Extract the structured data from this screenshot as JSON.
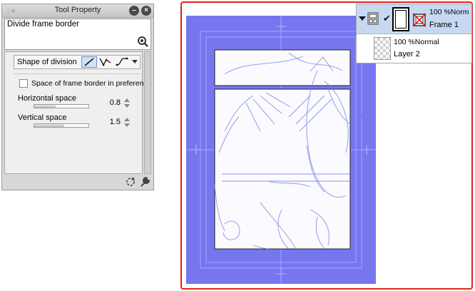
{
  "tool_property": {
    "title": "Tool Property",
    "tool_name": "Divide frame border",
    "shape_label": "Shape of division",
    "shape_options": [
      "straight-line-icon",
      "polyline-icon",
      "curve-icon"
    ],
    "preference_label": "Space of frame border in preference",
    "preference_checked": false,
    "horizontal": {
      "label": "Horizontal space",
      "value": "0.8"
    },
    "vertical": {
      "label": "Vertical space",
      "value": "1.5"
    }
  },
  "layers": {
    "frame_layer": {
      "opacity_blend": "100 %Norm",
      "name": "Frame 1"
    },
    "layer2": {
      "opacity_blend": "100 %Normal",
      "name": "Layer 2"
    }
  },
  "colors": {
    "frame_overlay": "#7878f0",
    "highlight_border": "#e2231a",
    "selected_row": "#c7d9f2"
  }
}
